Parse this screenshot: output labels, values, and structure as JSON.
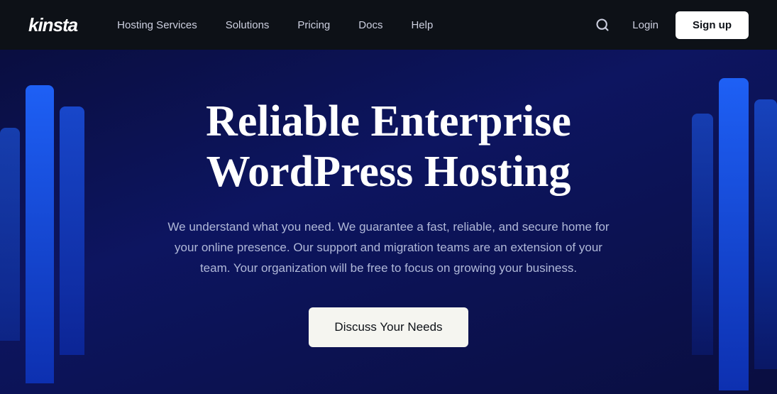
{
  "logo": {
    "text": "kinsta"
  },
  "nav": {
    "items": [
      {
        "label": "Hosting Services",
        "id": "hosting-services"
      },
      {
        "label": "Solutions",
        "id": "solutions"
      },
      {
        "label": "Pricing",
        "id": "pricing"
      },
      {
        "label": "Docs",
        "id": "docs"
      },
      {
        "label": "Help",
        "id": "help"
      }
    ],
    "login_label": "Login",
    "signup_label": "Sign up"
  },
  "hero": {
    "title_line1": "Reliable Enterprise",
    "title_line2": "WordPress Hosting",
    "subtitle": "We understand what you need. We guarantee a fast, reliable, and secure home for your online presence. Our support and migration teams are an extension of your team. Your organization will be free to focus on growing your business.",
    "cta_label": "Discuss Your Needs"
  }
}
